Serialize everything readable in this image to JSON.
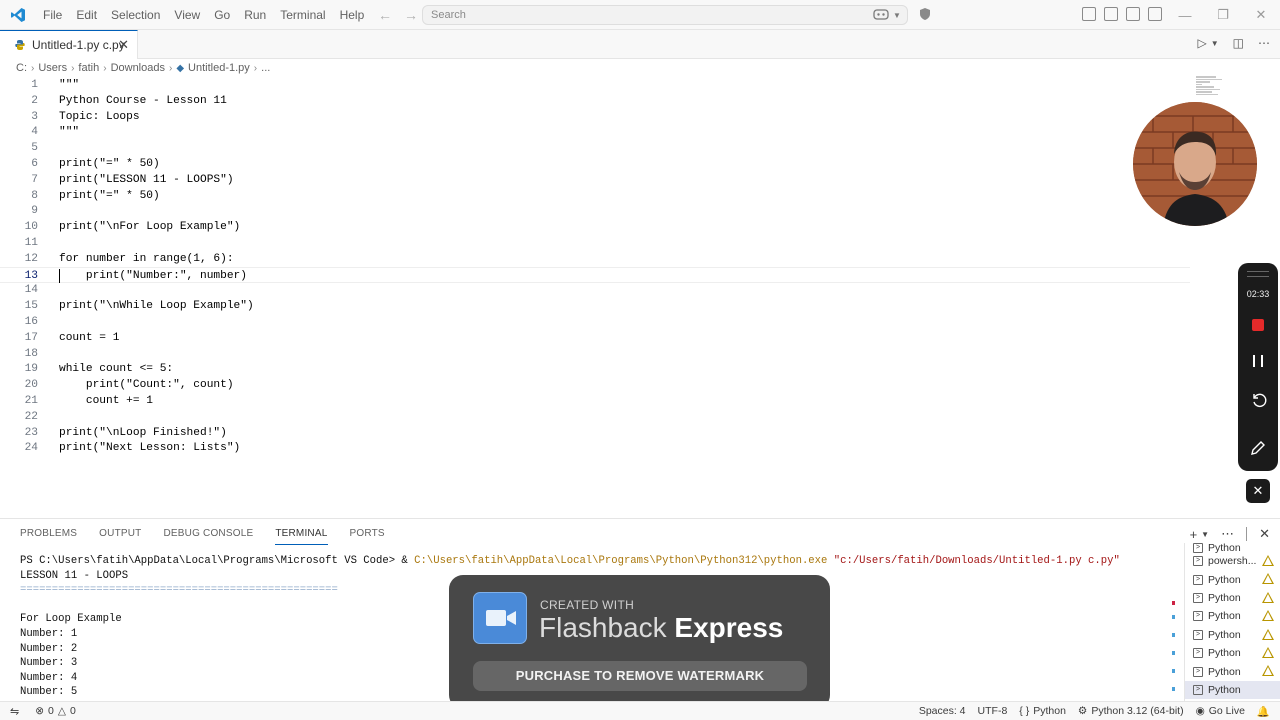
{
  "menu": [
    "File",
    "Edit",
    "Selection",
    "View",
    "Go",
    "Run",
    "Terminal",
    "Help"
  ],
  "search": {
    "placeholder": "Search"
  },
  "tab": {
    "label": "Untitled-1.py c.py"
  },
  "breadcrumb": [
    "C:",
    "Users",
    "fatih",
    "Downloads",
    "Untitled-1.py",
    "..."
  ],
  "editor": {
    "active_line": 13,
    "lines": [
      {
        "n": "1",
        "code": "\"\"\""
      },
      {
        "n": "2",
        "code": "Python Course - Lesson 11"
      },
      {
        "n": "3",
        "code": "Topic: Loops"
      },
      {
        "n": "4",
        "code": "\"\"\""
      },
      {
        "n": "5",
        "code": ""
      },
      {
        "n": "6",
        "code": "print(\"=\" * 50)"
      },
      {
        "n": "7",
        "code": "print(\"LESSON 11 - LOOPS\")"
      },
      {
        "n": "8",
        "code": "print(\"=\" * 50)"
      },
      {
        "n": "9",
        "code": ""
      },
      {
        "n": "10",
        "code": "print(\"\\nFor Loop Example\")"
      },
      {
        "n": "11",
        "code": ""
      },
      {
        "n": "12",
        "code": "for number in range(1, 6):"
      },
      {
        "n": "13",
        "code": "    print(\"Number:\", number)"
      },
      {
        "n": "14",
        "code": ""
      },
      {
        "n": "15",
        "code": "print(\"\\nWhile Loop Example\")"
      },
      {
        "n": "16",
        "code": ""
      },
      {
        "n": "17",
        "code": "count = 1"
      },
      {
        "n": "18",
        "code": ""
      },
      {
        "n": "19",
        "code": "while count <= 5:"
      },
      {
        "n": "20",
        "code": "    print(\"Count:\", count)"
      },
      {
        "n": "21",
        "code": "    count += 1"
      },
      {
        "n": "22",
        "code": ""
      },
      {
        "n": "23",
        "code": "print(\"\\nLoop Finished!\")"
      },
      {
        "n": "24",
        "code": "print(\"Next Lesson: Lists\")"
      }
    ]
  },
  "recorder": {
    "time": "02:33"
  },
  "panel": {
    "tabs": [
      "PROBLEMS",
      "OUTPUT",
      "DEBUG CONSOLE",
      "TERMINAL",
      "PORTS"
    ],
    "active_tab": "TERMINAL"
  },
  "terminal": {
    "prompt": "PS C:\\Users\\fatih\\AppData\\Local\\Programs\\Microsoft VS Code> & ",
    "exe_path": "C:\\Users\\fatih\\AppData\\Local\\Programs\\Python\\Python312\\python.exe",
    "script_arg": "\"c:/Users/fatih/Downloads/Untitled-1.py c.py\"",
    "output": [
      "LESSON 11 - LOOPS",
      "==================================================",
      "",
      "For Loop Example",
      "Number: 1",
      "Number: 2",
      "Number: 3",
      "Number: 4",
      "Number: 5"
    ]
  },
  "terminal_list": [
    {
      "label": "Python",
      "selected": false,
      "warn": false
    },
    {
      "label": "powersh...",
      "selected": false,
      "warn": true
    },
    {
      "label": "Python",
      "selected": false,
      "warn": true
    },
    {
      "label": "Python",
      "selected": false,
      "warn": true
    },
    {
      "label": "Python",
      "selected": false,
      "warn": true
    },
    {
      "label": "Python",
      "selected": false,
      "warn": true
    },
    {
      "label": "Python",
      "selected": false,
      "warn": true
    },
    {
      "label": "Python",
      "selected": false,
      "warn": true
    },
    {
      "label": "Python",
      "selected": true,
      "warn": false
    }
  ],
  "watermark": {
    "created": "CREATED WITH",
    "brand_a": "Flashback",
    "brand_b": "Express",
    "button": "PURCHASE TO REMOVE WATERMARK"
  },
  "status": {
    "errors": "0",
    "warnings": "0",
    "spaces": "Spaces: 4",
    "encoding": "UTF-8",
    "language": "Python",
    "interpreter": "Python 3.12 (64-bit)",
    "golive": "Go Live"
  },
  "colors": {
    "accent": "#005fb8",
    "record": "#e52a2a",
    "brand_icon": "#4a8ad8"
  }
}
